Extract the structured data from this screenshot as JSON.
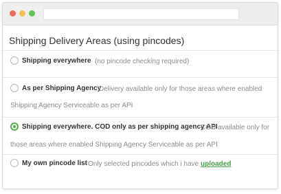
{
  "page": {
    "title": "Shipping Delivery Areas (using pincodes)"
  },
  "options": [
    {
      "label": "Shipping everywhere",
      "description": "(no pincode checking required)",
      "selected": false
    },
    {
      "label": "As per Shipping Agency",
      "description_line1": "Delivery available only for those areas where enabled",
      "description_line2": "Shipping Agency Serviceable as per API",
      "selected": false
    },
    {
      "label": "Shipping everywhere. COD only as per shipping agency API",
      "description_line1": "COD available only for",
      "description_line2": "those areas where enabled Shipping Agency Serviceable as per API",
      "selected": true
    },
    {
      "label": "My own pincode list",
      "description": "Only selected pincodes which i have",
      "link": "uploaded",
      "selected": false
    }
  ],
  "colors": {
    "accent": "#4caf50",
    "link": "#43a047",
    "text": "#333333",
    "muted": "#8c8c8c"
  }
}
